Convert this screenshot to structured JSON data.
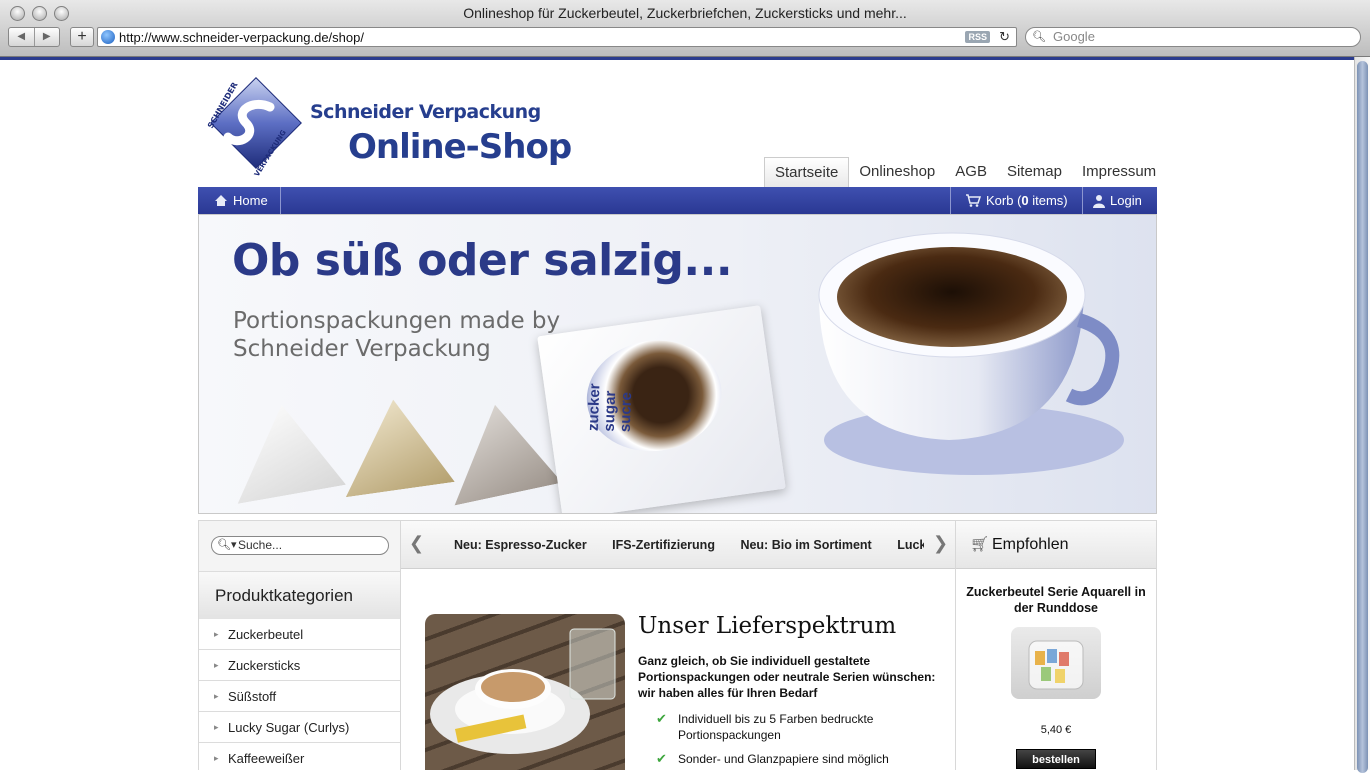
{
  "browser": {
    "window_title": "Onlineshop für Zuckerbeutel, Zuckerbriefchen, Zuckersticks und mehr...",
    "url": "http://www.schneider-verpackung.de/shop/",
    "rss_label": "RSS",
    "search_placeholder": "Google"
  },
  "header": {
    "brand_line1": "Schneider Verpackung",
    "brand_line2": "Online-Shop",
    "nav": [
      "Startseite",
      "Onlineshop",
      "AGB",
      "Sitemap",
      "Impressum"
    ]
  },
  "bluebar": {
    "home": "Home",
    "cart_label": "Korb (",
    "cart_count": "0",
    "cart_suffix": " items)",
    "login": "Login"
  },
  "hero": {
    "title": "Ob süß oder salzig...",
    "subtitle": "Portionspackungen made by Schneider Verpackung",
    "packet_text": "zucker sugar sucre"
  },
  "sidebar": {
    "search_placeholder": "Suche...",
    "heading": "Produktkategorien",
    "categories": [
      "Zuckerbeutel",
      "Zuckersticks",
      "Süßstoff",
      "Lucky Sugar (Curlys)",
      "Kaffeeweißer"
    ]
  },
  "ticker": [
    "Neu: Espresso-Zucker",
    "IFS-Zertifizierung",
    "Neu: Bio im Sortiment",
    "Lucky Su"
  ],
  "content": {
    "title": "Unser Lieferspektrum",
    "lead": "Ganz gleich, ob Sie individuell gestaltete Portionspackungen oder neutrale Serien wünschen: wir haben alles für Ihren Bedarf",
    "bullets": [
      "Individuell bis zu 5 Farben bedruckte Portionspackungen",
      "Sonder- und Glanzpapiere sind möglich"
    ]
  },
  "recommended": {
    "heading": "Empfohlen",
    "product_name": "Zuckerbeutel Serie Aquarell in der Runddose",
    "price": "5,40 €",
    "order_label": "bestellen"
  }
}
